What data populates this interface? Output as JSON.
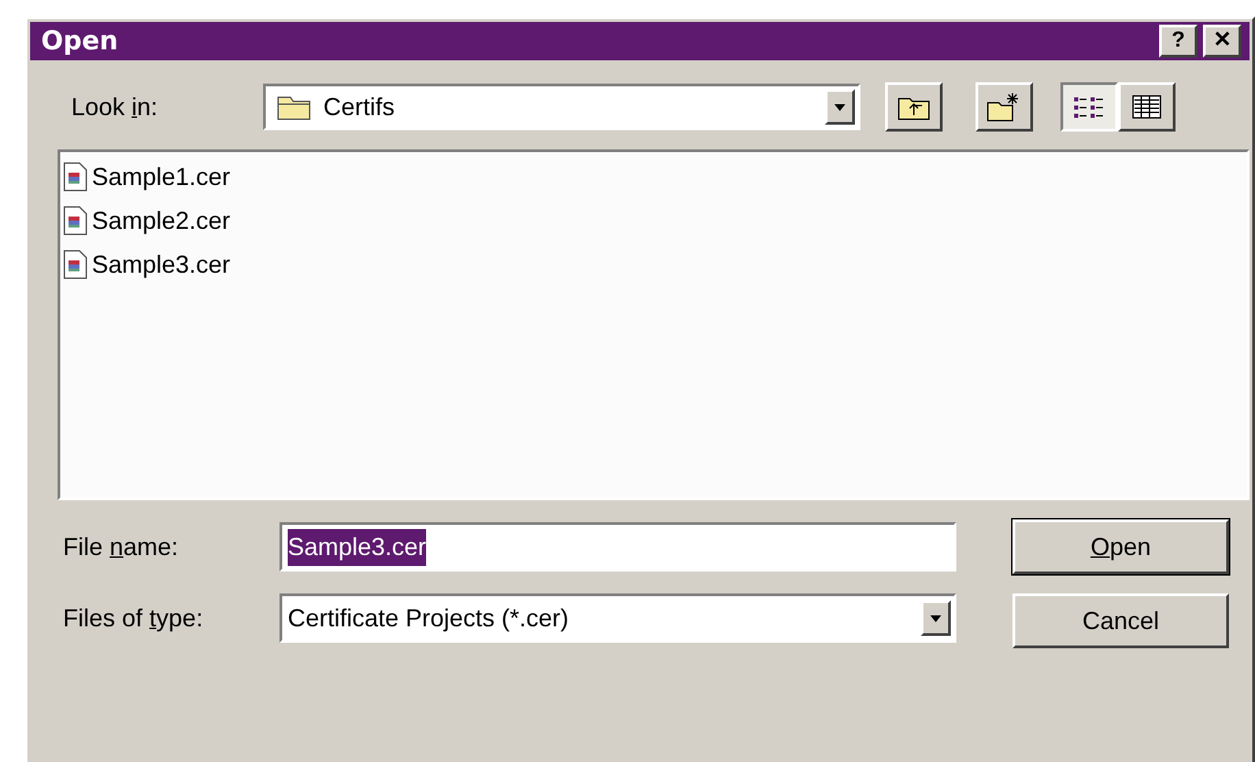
{
  "window": {
    "title": "Open",
    "title_buttons": [
      {
        "kind": "help",
        "label": "?"
      },
      {
        "kind": "close",
        "label": "✕"
      }
    ]
  },
  "look_in": {
    "label": {
      "before": "Look ",
      "key": "i",
      "after": "n:"
    },
    "value": "Certifs"
  },
  "toolbar": [
    {
      "kind": "up",
      "selected": false
    },
    {
      "kind": "new-folder",
      "selected": false
    },
    {
      "kind": "list",
      "selected": true
    },
    {
      "kind": "details",
      "selected": false
    }
  ],
  "files": [
    {
      "name": "Sample1.cer",
      "selected": false
    },
    {
      "name": "Sample2.cer",
      "selected": false
    },
    {
      "name": "Sample3.cer",
      "selected": false
    }
  ],
  "file_name": {
    "label": {
      "before": "File ",
      "key": "n",
      "after": "ame:"
    },
    "value": "Sample3.cer",
    "text_selected": true
  },
  "file_type": {
    "label": {
      "before": "Files of ",
      "key": "t",
      "after": "ype:"
    },
    "value": "Certificate Projects (*.cer)"
  },
  "buttons": [
    {
      "label": {
        "key": "O",
        "after": "pen"
      },
      "default": true
    },
    {
      "label": {
        "after": "Cancel"
      },
      "default": false
    }
  ]
}
